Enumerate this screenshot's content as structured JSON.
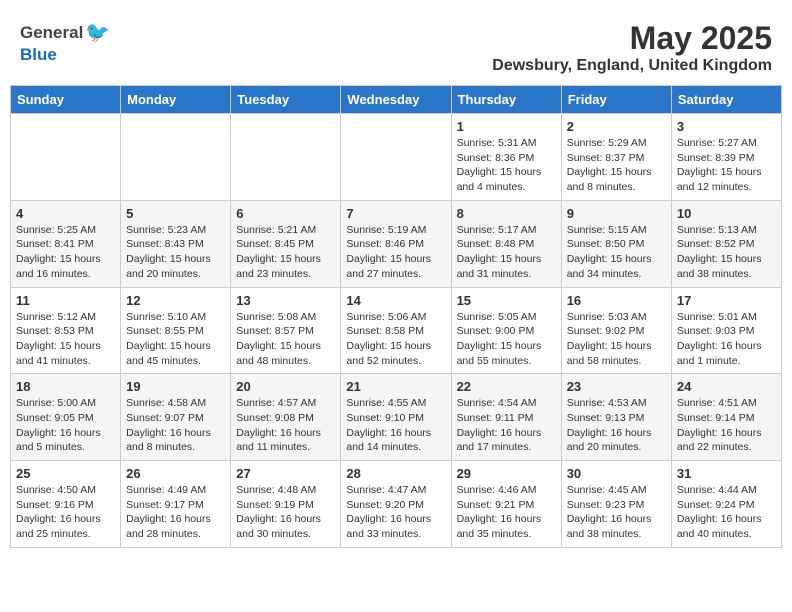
{
  "header": {
    "logo_general": "General",
    "logo_blue": "Blue",
    "month_title": "May 2025",
    "location": "Dewsbury, England, United Kingdom"
  },
  "weekdays": [
    "Sunday",
    "Monday",
    "Tuesday",
    "Wednesday",
    "Thursday",
    "Friday",
    "Saturday"
  ],
  "weeks": [
    [
      {
        "day": "",
        "info": ""
      },
      {
        "day": "",
        "info": ""
      },
      {
        "day": "",
        "info": ""
      },
      {
        "day": "",
        "info": ""
      },
      {
        "day": "1",
        "info": "Sunrise: 5:31 AM\nSunset: 8:36 PM\nDaylight: 15 hours\nand 4 minutes."
      },
      {
        "day": "2",
        "info": "Sunrise: 5:29 AM\nSunset: 8:37 PM\nDaylight: 15 hours\nand 8 minutes."
      },
      {
        "day": "3",
        "info": "Sunrise: 5:27 AM\nSunset: 8:39 PM\nDaylight: 15 hours\nand 12 minutes."
      }
    ],
    [
      {
        "day": "4",
        "info": "Sunrise: 5:25 AM\nSunset: 8:41 PM\nDaylight: 15 hours\nand 16 minutes."
      },
      {
        "day": "5",
        "info": "Sunrise: 5:23 AM\nSunset: 8:43 PM\nDaylight: 15 hours\nand 20 minutes."
      },
      {
        "day": "6",
        "info": "Sunrise: 5:21 AM\nSunset: 8:45 PM\nDaylight: 15 hours\nand 23 minutes."
      },
      {
        "day": "7",
        "info": "Sunrise: 5:19 AM\nSunset: 8:46 PM\nDaylight: 15 hours\nand 27 minutes."
      },
      {
        "day": "8",
        "info": "Sunrise: 5:17 AM\nSunset: 8:48 PM\nDaylight: 15 hours\nand 31 minutes."
      },
      {
        "day": "9",
        "info": "Sunrise: 5:15 AM\nSunset: 8:50 PM\nDaylight: 15 hours\nand 34 minutes."
      },
      {
        "day": "10",
        "info": "Sunrise: 5:13 AM\nSunset: 8:52 PM\nDaylight: 15 hours\nand 38 minutes."
      }
    ],
    [
      {
        "day": "11",
        "info": "Sunrise: 5:12 AM\nSunset: 8:53 PM\nDaylight: 15 hours\nand 41 minutes."
      },
      {
        "day": "12",
        "info": "Sunrise: 5:10 AM\nSunset: 8:55 PM\nDaylight: 15 hours\nand 45 minutes."
      },
      {
        "day": "13",
        "info": "Sunrise: 5:08 AM\nSunset: 8:57 PM\nDaylight: 15 hours\nand 48 minutes."
      },
      {
        "day": "14",
        "info": "Sunrise: 5:06 AM\nSunset: 8:58 PM\nDaylight: 15 hours\nand 52 minutes."
      },
      {
        "day": "15",
        "info": "Sunrise: 5:05 AM\nSunset: 9:00 PM\nDaylight: 15 hours\nand 55 minutes."
      },
      {
        "day": "16",
        "info": "Sunrise: 5:03 AM\nSunset: 9:02 PM\nDaylight: 15 hours\nand 58 minutes."
      },
      {
        "day": "17",
        "info": "Sunrise: 5:01 AM\nSunset: 9:03 PM\nDaylight: 16 hours\nand 1 minute."
      }
    ],
    [
      {
        "day": "18",
        "info": "Sunrise: 5:00 AM\nSunset: 9:05 PM\nDaylight: 16 hours\nand 5 minutes."
      },
      {
        "day": "19",
        "info": "Sunrise: 4:58 AM\nSunset: 9:07 PM\nDaylight: 16 hours\nand 8 minutes."
      },
      {
        "day": "20",
        "info": "Sunrise: 4:57 AM\nSunset: 9:08 PM\nDaylight: 16 hours\nand 11 minutes."
      },
      {
        "day": "21",
        "info": "Sunrise: 4:55 AM\nSunset: 9:10 PM\nDaylight: 16 hours\nand 14 minutes."
      },
      {
        "day": "22",
        "info": "Sunrise: 4:54 AM\nSunset: 9:11 PM\nDaylight: 16 hours\nand 17 minutes."
      },
      {
        "day": "23",
        "info": "Sunrise: 4:53 AM\nSunset: 9:13 PM\nDaylight: 16 hours\nand 20 minutes."
      },
      {
        "day": "24",
        "info": "Sunrise: 4:51 AM\nSunset: 9:14 PM\nDaylight: 16 hours\nand 22 minutes."
      }
    ],
    [
      {
        "day": "25",
        "info": "Sunrise: 4:50 AM\nSunset: 9:16 PM\nDaylight: 16 hours\nand 25 minutes."
      },
      {
        "day": "26",
        "info": "Sunrise: 4:49 AM\nSunset: 9:17 PM\nDaylight: 16 hours\nand 28 minutes."
      },
      {
        "day": "27",
        "info": "Sunrise: 4:48 AM\nSunset: 9:19 PM\nDaylight: 16 hours\nand 30 minutes."
      },
      {
        "day": "28",
        "info": "Sunrise: 4:47 AM\nSunset: 9:20 PM\nDaylight: 16 hours\nand 33 minutes."
      },
      {
        "day": "29",
        "info": "Sunrise: 4:46 AM\nSunset: 9:21 PM\nDaylight: 16 hours\nand 35 minutes."
      },
      {
        "day": "30",
        "info": "Sunrise: 4:45 AM\nSunset: 9:23 PM\nDaylight: 16 hours\nand 38 minutes."
      },
      {
        "day": "31",
        "info": "Sunrise: 4:44 AM\nSunset: 9:24 PM\nDaylight: 16 hours\nand 40 minutes."
      }
    ]
  ]
}
